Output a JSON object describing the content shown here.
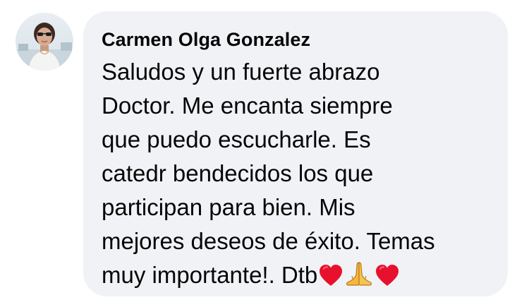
{
  "comment": {
    "author": "Carmen Olga Gonzalez",
    "text": "Saludos y un fuerte abrazo\nDoctor. Me encanta siempre\nque puedo escucharle. Es\ncatedr bendecidos los que\nparticipan para bien. Mis\nmejores deseos de éxito. Temas\nmuy importante!. Dtb",
    "emojis": [
      "red-heart",
      "folded-hands",
      "red-heart"
    ],
    "colors": {
      "bubble": "#f0f2f5",
      "text": "#050505",
      "heart": "#e8112d",
      "hands": "#f5b83d"
    }
  }
}
